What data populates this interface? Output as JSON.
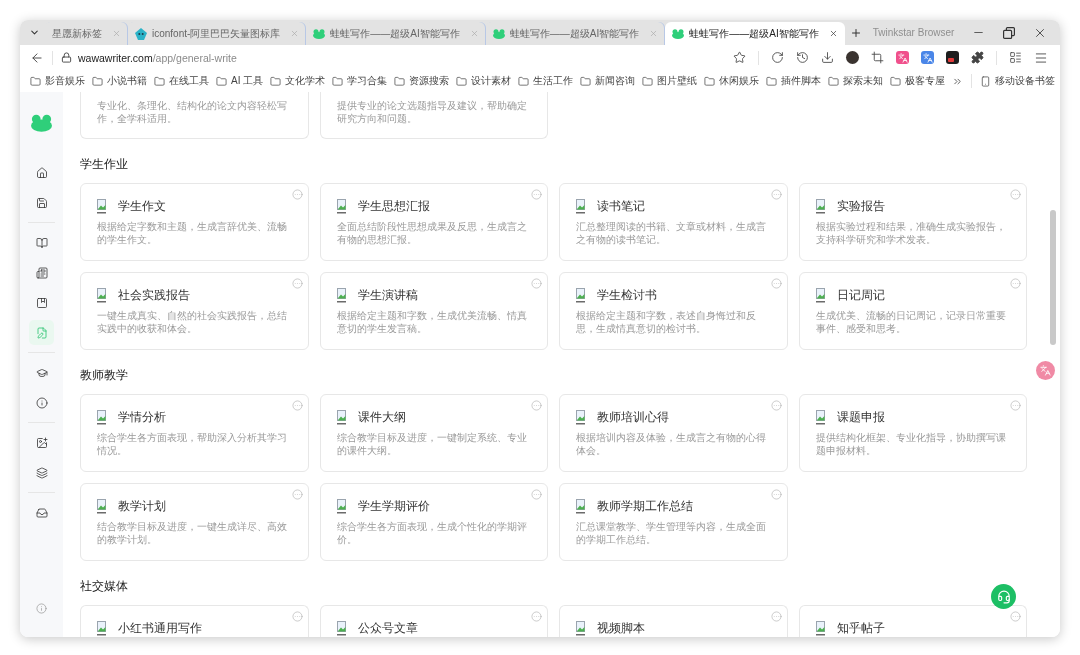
{
  "browser": {
    "tabs": [
      {
        "kind": "plain",
        "title": "星愿新标签",
        "selected": false
      },
      {
        "kind": "iconfont",
        "title": "iconfont-阿里巴巴矢量图标库",
        "selected": false
      },
      {
        "kind": "frog",
        "title": "蛙蛙写作——超级AI智能写作",
        "selected": false
      },
      {
        "kind": "frog",
        "title": "蛙蛙写作——超级AI智能写作",
        "selected": false
      },
      {
        "kind": "frog",
        "title": "蛙蛙写作——超级AI智能写作",
        "selected": true
      }
    ],
    "brand": "Twinkstar Browser"
  },
  "address": {
    "domain": "wawawriter.com",
    "path": "/app/general-write"
  },
  "bookmarks": {
    "folders": [
      "影音娱乐",
      "小说书籍",
      "在线工具",
      "AI 工具",
      "文化学术",
      "学习合集",
      "资源搜索",
      "设计素材",
      "生活工作",
      "新闻咨询",
      "图片壁纸",
      "休闲娱乐",
      "插件脚本",
      "探索未知",
      "极客专屋"
    ],
    "mobile": "移动设备书签"
  },
  "sidebar": {
    "groups": [
      {
        "items": [
          {
            "selected": false
          },
          {
            "selected": false
          }
        ]
      },
      {
        "items": [
          {
            "selected": false
          },
          {
            "selected": false
          },
          {
            "selected": false
          },
          {
            "selected": true
          }
        ]
      },
      {
        "items": [
          {
            "selected": false
          },
          {
            "selected": false
          }
        ]
      },
      {
        "items": [
          {
            "selected": false
          },
          {
            "selected": false
          }
        ]
      },
      {
        "items": [
          {
            "selected": false
          }
        ]
      }
    ]
  },
  "top_cards": [
    {
      "description": "专业化、条理化、结构化的论文内容轻松写作，全学科适用。"
    },
    {
      "description": "提供专业的论文选题指导及建议，帮助确定研究方向和问题。"
    }
  ],
  "sections": [
    {
      "title": "学生作业",
      "cards": [
        {
          "title": "学生作文",
          "description": "根据给定字数和主题，生成言辞优美、流畅的学生作文。"
        },
        {
          "title": "学生思想汇报",
          "description": "全面总结阶段性思想成果及反思，生成言之有物的思想汇报。"
        },
        {
          "title": "读书笔记",
          "description": "汇总整理阅读的书籍、文章或材料，生成言之有物的读书笔记。"
        },
        {
          "title": "实验报告",
          "description": "根据实验过程和结果，准确生成实验报告，支持科学研究和学术发表。"
        },
        {
          "title": "社会实践报告",
          "description": "一键生成真实、自然的社会实践报告，总结实践中的收获和体会。"
        },
        {
          "title": "学生演讲稿",
          "description": "根据给定主题和字数，生成优美流畅、情真意切的学生发言稿。"
        },
        {
          "title": "学生检讨书",
          "description": "根据给定主题和字数，表述自身悔过和反思，生成情真意切的检讨书。"
        },
        {
          "title": "日记周记",
          "description": "生成优美、流畅的日记周记，记录日常重要事件、感受和思考。"
        }
      ]
    },
    {
      "title": "教师教学",
      "cards": [
        {
          "title": "学情分析",
          "description": "综合学生各方面表现，帮助深入分析其学习情况。"
        },
        {
          "title": "课件大纲",
          "description": "综合教学目标及进度，一键制定系统、专业的课件大纲。"
        },
        {
          "title": "教师培训心得",
          "description": "根据培训内容及体验，生成言之有物的心得体会。"
        },
        {
          "title": "课题申报",
          "description": "提供结构化框架、专业化指导，协助撰写课题申报材料。"
        },
        {
          "title": "教学计划",
          "description": "结合教学目标及进度，一键生成详尽、高效的教学计划。"
        },
        {
          "title": "学生学期评价",
          "description": "综合学生各方面表现，生成个性化的学期评价。"
        },
        {
          "title": "教师学期工作总结",
          "description": "汇总课堂教学、学生管理等内容，生成全面的学期工作总结。"
        }
      ]
    },
    {
      "title": "社交媒体",
      "cards": [
        {
          "title": "小红书通用写作"
        },
        {
          "title": "公众号文章"
        },
        {
          "title": "视频脚本"
        },
        {
          "title": "知乎帖子"
        }
      ]
    }
  ]
}
